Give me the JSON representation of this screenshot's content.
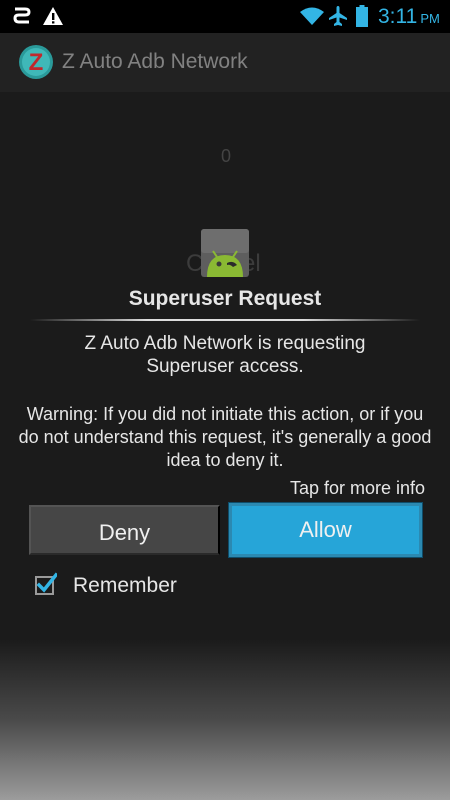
{
  "status_bar": {
    "time": "3:11",
    "ampm": "PM",
    "icons": [
      "usb-icon",
      "warning-icon",
      "wifi-icon",
      "airplane-mode-icon",
      "battery-icon"
    ],
    "accent_color": "#33b5e5"
  },
  "app_bar": {
    "title": "Z Auto Adb Network",
    "logo_letter": "Z"
  },
  "background": {
    "counter": "0",
    "cancel_label": "Cancel"
  },
  "dialog": {
    "title": "Superuser Request",
    "request_message": "Z Auto Adb Network is requesting Superuser access.",
    "warning_message": "Warning: If you did not initiate this action, or if you do not understand this request, it's generally a good idea to deny it.",
    "more_info_label": "Tap for more info",
    "deny_label": "Deny",
    "allow_label": "Allow",
    "remember_label": "Remember",
    "remember_checked": true,
    "allow_color": "#26a5d8"
  }
}
